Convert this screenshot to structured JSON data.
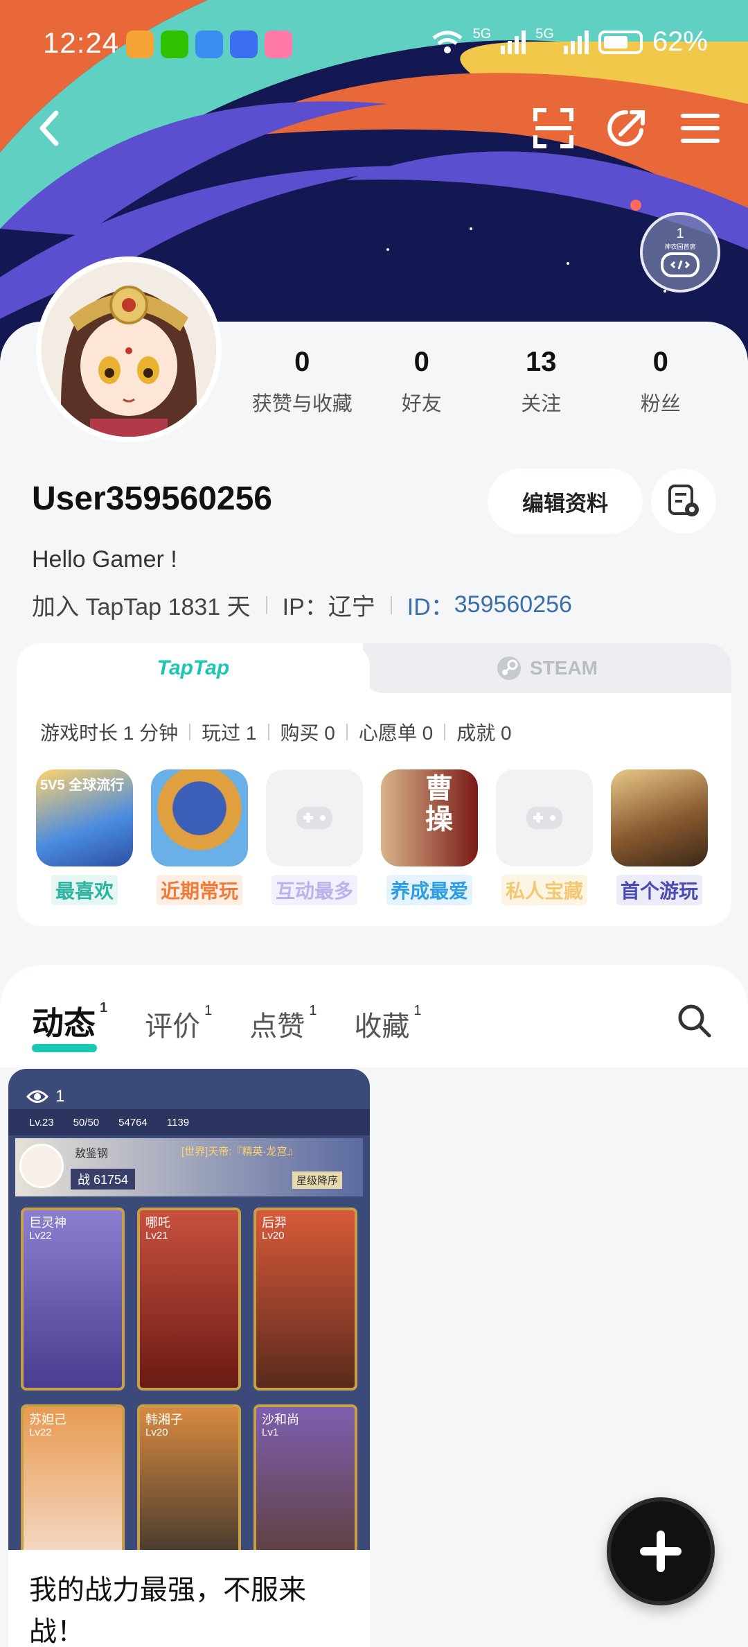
{
  "status_bar": {
    "time": "12:24",
    "net1": "5G",
    "net2": "5G",
    "battery": "62%"
  },
  "profile": {
    "username": "User359560256",
    "bio": "Hello Gamer !",
    "joined": "加入 TapTap 1831 天",
    "ip": "IP：辽宁",
    "id_label": "ID：",
    "id_value": "359560256",
    "edit_label": "编辑资料",
    "badge_count": "1",
    "badge_text": "神农园首席"
  },
  "stats": [
    {
      "value": "0",
      "label": "获赞与收藏"
    },
    {
      "value": "0",
      "label": "好友"
    },
    {
      "value": "13",
      "label": "关注"
    },
    {
      "value": "0",
      "label": "粉丝"
    }
  ],
  "platforms": {
    "taptap": "TapTap",
    "steam": "STEAM"
  },
  "game_stats": [
    "游戏时长 1 分钟",
    "玩过 1",
    "购买 0",
    "心愿单 0",
    "成就 0"
  ],
  "games": [
    {
      "label": "最喜欢",
      "color": "#2bb5a0",
      "bg": "#e6f6f3",
      "tile_text": "5V5 全球流行"
    },
    {
      "label": "近期常玩",
      "color": "#f07a36",
      "bg": "#fdeee4"
    },
    {
      "label": "互动最多",
      "color": "#b9b3ec",
      "bg": "#f2f0fc"
    },
    {
      "label": "养成最爱",
      "color": "#2f9de3",
      "bg": "#e5f3fc",
      "tile_text": "曹操"
    },
    {
      "label": "私人宝藏",
      "color": "#f3c874",
      "bg": "#fdf5e4"
    },
    {
      "label": "首个游玩",
      "color": "#4a4bb5",
      "bg": "#ececf8"
    }
  ],
  "feed_tabs": [
    {
      "label": "动态",
      "count": "1"
    },
    {
      "label": "评价",
      "count": "1"
    },
    {
      "label": "点赞",
      "count": "1"
    },
    {
      "label": "收藏",
      "count": "1"
    }
  ],
  "post": {
    "views": "1",
    "text": "我的战力最强，不服来战！",
    "player_level": "Lv.23",
    "stamina": "50/50",
    "gold": "54764",
    "gems": "1139",
    "player_name": "敖鉴钢",
    "power": "战 61754",
    "world_msg": "[世界]天帝:『精英·龙宫』",
    "sort_label": "星级降序",
    "heroes": [
      {
        "name": "巨灵神",
        "lv": "Lv22",
        "color": "#8a7fd0"
      },
      {
        "name": "哪吒",
        "lv": "Lv21",
        "color": "#c8503e"
      },
      {
        "name": "后羿",
        "lv": "Lv20",
        "color": "#c8503e"
      },
      {
        "name": "苏妲己",
        "lv": "Lv22",
        "color": "#d88a40"
      },
      {
        "name": "韩湘子",
        "lv": "Lv20",
        "color": "#d88a40"
      },
      {
        "name": "沙和尚",
        "lv": "Lv1",
        "color": "#7d5fb0"
      }
    ]
  }
}
